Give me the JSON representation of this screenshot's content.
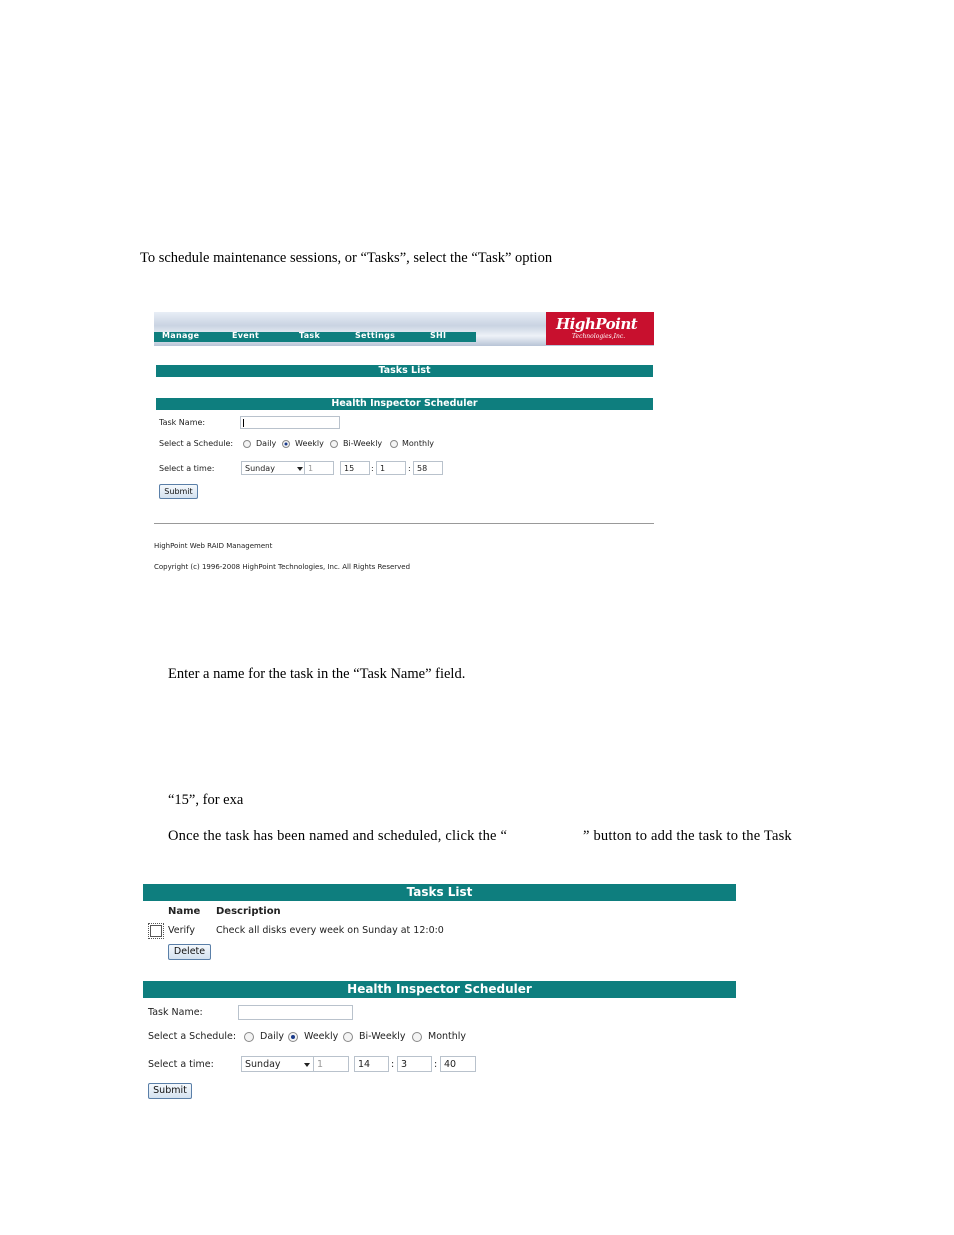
{
  "doc": {
    "intro": "To schedule maintenance sessions, or “Tasks”, select the “Task” option",
    "step_name": "Enter a name for the task in the “Task Name” field.",
    "step_example": "“15”, for exa",
    "step_submit_a": "Once the task has been named and scheduled, click the “",
    "step_submit_b": "” button to add the task to the Task"
  },
  "shot1": {
    "nav": [
      "Manage",
      "Event",
      "Task",
      "Settings",
      "SHI"
    ],
    "logo": {
      "line1": "HighPoint",
      "line2": "Technologies,Inc."
    },
    "tasks_list_title": "Tasks List",
    "scheduler_title": "Health Inspector Scheduler",
    "task_name_label": "Task Name:",
    "schedule_label": "Select a Schedule:",
    "schedule_options": [
      "Daily",
      "Weekly",
      "Bi-Weekly",
      "Monthly"
    ],
    "time_label": "Select a time:",
    "day": "Sunday",
    "date_field": "1",
    "hour": "15",
    "minute": "1",
    "second": "58",
    "colon": ":",
    "submit": "Submit",
    "footer1": "HighPoint Web RAID Management",
    "footer2": "Copyright (c) 1996-2008 HighPoint Technologies, Inc. All Rights Reserved"
  },
  "shot2": {
    "tasks_list_title": "Tasks List",
    "col_name": "Name",
    "col_description": "Description",
    "task_name": "Verify",
    "task_description": "Check all disks every week on Sunday at 12:0:0",
    "delete": "Delete",
    "scheduler_title": "Health Inspector Scheduler",
    "task_name_label": "Task Name:",
    "schedule_label": "Select a Schedule:",
    "schedule_options": [
      "Daily",
      "Weekly",
      "Bi-Weekly",
      "Monthly"
    ],
    "time_label": "Select a time:",
    "day": "Sunday",
    "date_field": "1",
    "hour": "14",
    "minute": "3",
    "second": "40",
    "colon": ":",
    "submit": "Submit"
  }
}
